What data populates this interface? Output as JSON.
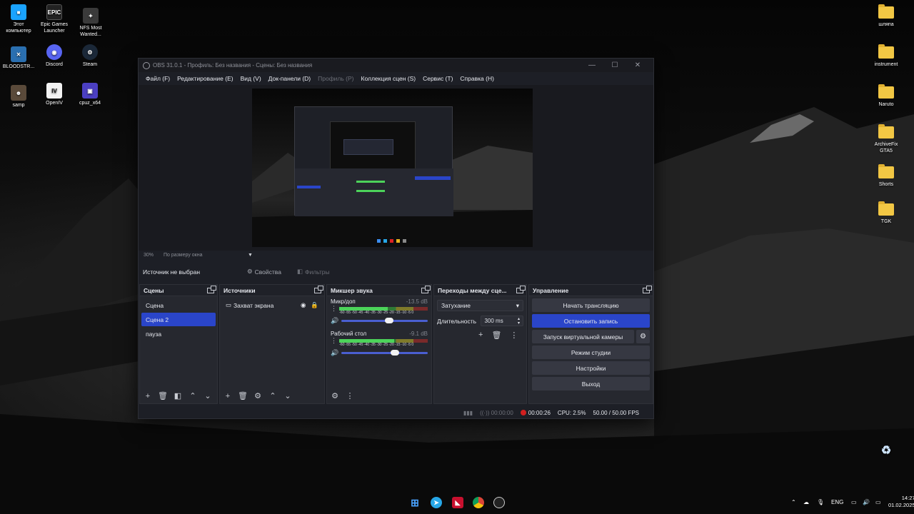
{
  "desktop": {
    "left_icons": [
      {
        "label": "Этот компьютер",
        "icon": "computer-icon",
        "color": "#1aa3ff"
      },
      {
        "label": "Epic Games Launcher",
        "icon": "epic-games-icon",
        "color": "#222222",
        "glyph": "EPIC"
      },
      {
        "label": "NFS Most Wanted...",
        "icon": "nfs-icon",
        "color": "#3a3a3a"
      },
      {
        "label": "BLOODSTR...",
        "icon": "bloodstrike-icon",
        "color": "#2a6fb0"
      },
      {
        "label": "Discord",
        "icon": "discord-icon",
        "color": "#5865f2"
      },
      {
        "label": "Steam",
        "icon": "steam-icon",
        "color": "#1b2838"
      },
      {
        "label": "samp",
        "icon": "samp-icon",
        "color": "#5a4a3a"
      },
      {
        "label": "OpenIV",
        "icon": "openiv-icon",
        "color": "#f2f2f2",
        "glyph": "IV"
      },
      {
        "label": "cpuz_x64",
        "icon": "cpuz-icon",
        "color": "#4b3fc2"
      }
    ],
    "right_folders": [
      {
        "label": "шляпа"
      },
      {
        "label": "instrument"
      },
      {
        "label": "Naruto"
      },
      {
        "label": "ArchiveFix GTA5"
      },
      {
        "label": "Shorts"
      },
      {
        "label": "TGK"
      }
    ],
    "recycle_bin_icon": "recycle-bin-icon"
  },
  "obs": {
    "title": "OBS 31.0.1 - Профиль: Без названия - Сцены: Без названия",
    "menu": [
      {
        "label": "Файл (F)",
        "disabled": false
      },
      {
        "label": "Редактирование (E)",
        "disabled": false
      },
      {
        "label": "Вид (V)",
        "disabled": false
      },
      {
        "label": "Док-панели (D)",
        "disabled": false
      },
      {
        "label": "Профиль (P)",
        "disabled": true
      },
      {
        "label": "Коллекция сцен (S)",
        "disabled": false
      },
      {
        "label": "Сервис (T)",
        "disabled": false
      },
      {
        "label": "Справка (H)",
        "disabled": false
      }
    ],
    "zoom": {
      "percent": "30%",
      "mode": "По размеру окна"
    },
    "source_bar": {
      "no_source": "Источник не выбран",
      "properties": "Свойства",
      "filters": "Фильтры"
    },
    "scenes": {
      "title": "Сцены",
      "items": [
        "Сцена",
        "Сцена 2",
        "пауза"
      ],
      "selected_index": 1
    },
    "sources": {
      "title": "Источники",
      "items": [
        {
          "label": "Захват экрана",
          "visible": true,
          "locked": true
        }
      ]
    },
    "mixer": {
      "title": "Микшер звука",
      "channels": [
        {
          "name": "Микр/доп",
          "db": "-13.5 dB",
          "level": 0.55,
          "volume": 0.55
        },
        {
          "name": "Рабочий стол",
          "db": "-9.1 dB",
          "level": 0.62,
          "volume": 0.62
        }
      ],
      "ticks": "-60 -55 -50 -45 -40 -35 -30 -25 -20 -15 -10 -5 0"
    },
    "transitions": {
      "title": "Переходы между сце...",
      "selected": "Затухание",
      "duration_label": "Длительность",
      "duration_value": "300 ms"
    },
    "controls": {
      "title": "Управление",
      "start_stream": "Начать трансляцию",
      "stop_record": "Остановить запись",
      "virtual_camera": "Запуск виртуальной камеры",
      "studio_mode": "Режим студии",
      "settings": "Настройки",
      "exit": "Выход"
    },
    "status": {
      "stream_time": "00:00:00",
      "record_time": "00:00:26",
      "cpu": "CPU: 2.5%",
      "fps": "50.00 / 50.00 FPS"
    }
  },
  "taskbar": {
    "apps": [
      "windows-start-icon",
      "telegram-icon",
      "amd-icon",
      "chrome-icon",
      "obs-icon"
    ],
    "lang": "ENG",
    "time": "14:27",
    "date": "01.02.2025"
  }
}
